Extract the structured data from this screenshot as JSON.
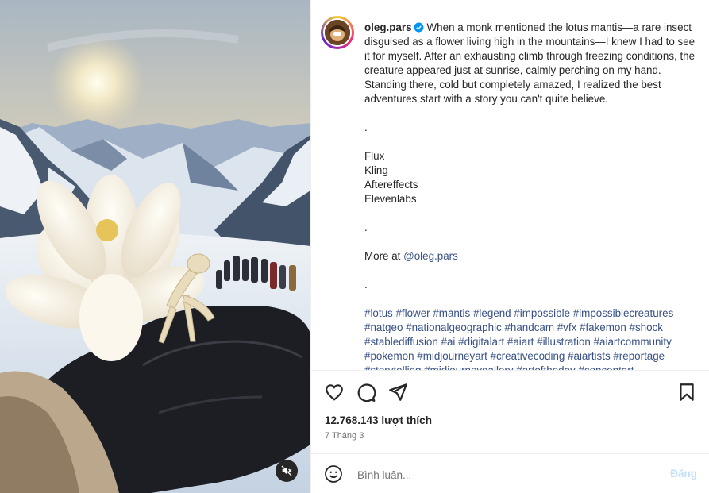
{
  "post": {
    "username": "oleg.pars",
    "caption_intro": "When a monk mentioned the lotus mantis—a rare insect disguised as a flower living high in the mountains—I knew I had to see it for myself. After an exhausting climb through freezing conditions, the creature appeared just at sunrise, calmly perching on my hand. Standing there, cold but completely amazed, I realized the best adventures start with a story you can't quite believe.",
    "dot1": ".",
    "tools": [
      "Flux",
      "Kling",
      "Aftereffects",
      "Elevenlabs"
    ],
    "dot2": ".",
    "more_at_label": "More at",
    "more_at_link": "@oleg.pars",
    "dot3": ".",
    "hashtags": "#lotus #flower #mantis #legend #impossible #impossiblecreatures #natgeo #nationalgeographic #handcam #vfx #fakemon #shock #stablediffusion #ai #digitalart #aiart #illustration #aiartcommunity #pokemon #midjourneyart #creativecoding #aiartists #reportage #storytelling #midjourneygallery #artoftheday #concentart"
  },
  "stats": {
    "likes": "12.768.143 lượt thích",
    "date": "7 Tháng 3"
  },
  "comment": {
    "placeholder": "Bình luận...",
    "post_label": "Đăng"
  },
  "icons": {
    "verified": "verified-badge-icon",
    "like": "heart-icon",
    "comment": "comment-icon",
    "share": "share-icon",
    "save": "bookmark-icon",
    "emoji": "emoji-icon",
    "mute": "muted-speaker-icon"
  },
  "colors": {
    "verified_blue": "#0095f6",
    "hashtag_link": "#385185",
    "post_button_disabled": "#c0dffd"
  }
}
